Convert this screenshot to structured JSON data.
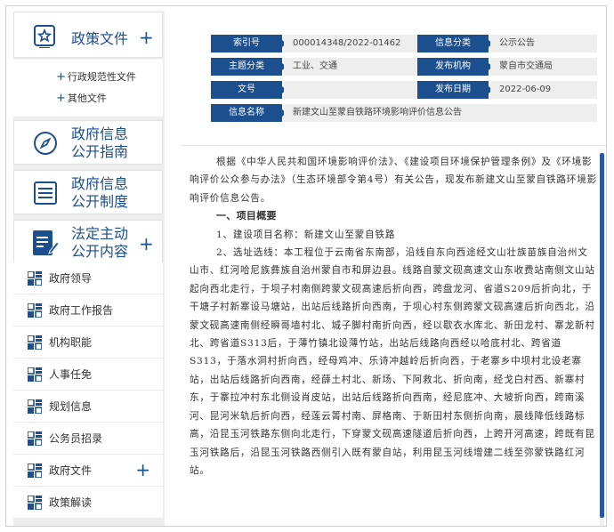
{
  "sidebar": {
    "policy_docs": {
      "title": "政策文件",
      "sub_items": [
        "行政规范性文件",
        "其他文件"
      ]
    },
    "guide": {
      "title_line1": "政府信息",
      "title_line2": "公开指南"
    },
    "system": {
      "title_line1": "政府信息",
      "title_line2": "公开制度"
    },
    "statutory": {
      "title_line1": "法定主动",
      "title_line2": "公开内容"
    },
    "menu_items": [
      {
        "label": "政府领导"
      },
      {
        "label": "政府工作报告"
      },
      {
        "label": "机构职能"
      },
      {
        "label": "人事任免"
      },
      {
        "label": "规划信息"
      },
      {
        "label": "公务员招录"
      },
      {
        "label": "政府文件"
      },
      {
        "label": "政策解读"
      }
    ],
    "plus_symbol": "+"
  },
  "info": {
    "index_label": "索引号",
    "index_value": "000014348/2022-01462",
    "category_label": "信息分类",
    "category_value": "公示公告",
    "topic_label": "主题分类",
    "topic_value": "工业、交通",
    "publisher_label": "发布机构",
    "publisher_value": "蒙自市交通局",
    "doc_no_label": "文号",
    "doc_no_value": "",
    "date_label": "发布日期",
    "date_value": "2022-06-09",
    "name_label": "信息名称",
    "name_value": "新建文山至蒙自铁路环境影响评价信息公告"
  },
  "content": {
    "intro": "根据《中华人民共和国环境影响评价法》、《建设项目环境保护管理条例》及《环境影响评价公众参与办法》（生态环境部令第4号）有关公告，现发布新建文山至蒙自铁路环境影响评价信息公告。",
    "heading1": "一、项目概要",
    "item1": "1、建设项目名称：新建文山至蒙自铁路",
    "item2": "2、选址选线：本工程位于云南省东南部，沿线自东向西途经文山壮族苗族自治州文山市、红河哈尼族彝族自治州蒙自市和屏边县。线路自蒙文砚高速文山东收费站南侧文山站起向西北走行，于坝子村南侧跨蒙文砚高速后折向西，跨盘龙河、省道S209后折向北，于干塘子村新寨设马塘站，出站后线路折向西南，于坝心村东侧跨蒙文砚高速后折向西北，沿蒙文砚高速南侧经瞬哥墙村北、城子脚村南折向西，经以歇衣水库北、新田龙村、寨龙新村北、跨省道S313后，于薄竹镇北设薄竹站，出站后线路向西经以哈底村北、跨省道S313，于落水洞村折向西，经母鸡冲、乐诗冲越岭后折向西，于老寨乡中坝村北设老寨站，出站后线路折向西南，经薛土村北、新场、下阿救北、折向南，经戈白村西、新寨村东，于寨拉冲村东北侧设肖皮站，出站后线路折向西南，经尼底冲、大坡折向西，跨南溪河、昆河米轨后折向西，经莲云箐村南、屏格南、于新田村东侧折向南，晨线降低线路标高，沿昆玉河铁路东侧向北走行，下穿蒙文砚高速隧道后折向西，上跨开河高速，跨既有昆玉河铁路后，沿昆玉河铁路西侧引入既有蒙自站，利用昆玉河线增建二线至弥蒙铁路红河站。"
  },
  "colors": {
    "accent": "#1c4f8e",
    "sidebar_bg": "#eeeeee",
    "value_bg": "#eeeeee",
    "scrollbar": "#2b56a8"
  }
}
